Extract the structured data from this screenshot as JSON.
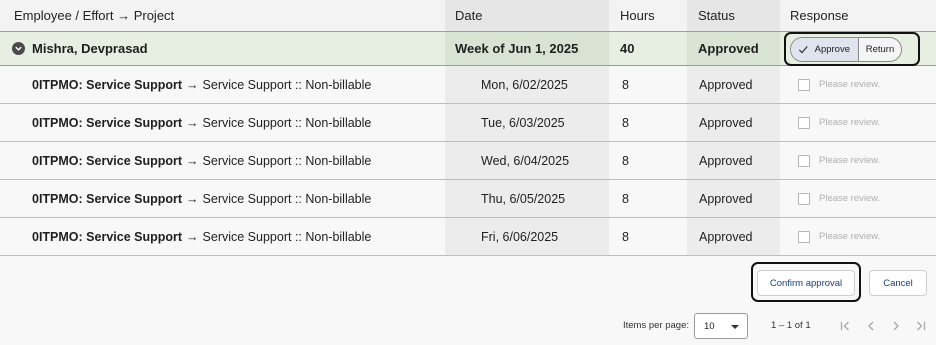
{
  "header": {
    "employee_col": "Employee / Effort → Project",
    "date_col": "Date",
    "hours_col": "Hours",
    "status_col": "Status",
    "response_col": "Response"
  },
  "group": {
    "name": "Mishra, Devprasad",
    "week": "Week of Jun 1, 2025",
    "hours": "40",
    "status": "Approved",
    "approve_label": "Approve",
    "return_label": "Return"
  },
  "rows": [
    {
      "project_code": "0ITPMO: Service Support",
      "project_detail": "Service Support :: Non-billable",
      "date": "Mon, 6/02/2025",
      "hours": "8",
      "status": "Approved",
      "review_placeholder": "Please review."
    },
    {
      "project_code": "0ITPMO: Service Support",
      "project_detail": "Service Support :: Non-billable",
      "date": "Tue, 6/03/2025",
      "hours": "8",
      "status": "Approved",
      "review_placeholder": "Please review."
    },
    {
      "project_code": "0ITPMO: Service Support",
      "project_detail": "Service Support :: Non-billable",
      "date": "Wed, 6/04/2025",
      "hours": "8",
      "status": "Approved",
      "review_placeholder": "Please review."
    },
    {
      "project_code": "0ITPMO: Service Support",
      "project_detail": "Service Support :: Non-billable",
      "date": "Thu, 6/05/2025",
      "hours": "8",
      "status": "Approved",
      "review_placeholder": "Please review."
    },
    {
      "project_code": "0ITPMO: Service Support",
      "project_detail": "Service Support :: Non-billable",
      "date": "Fri, 6/06/2025",
      "hours": "8",
      "status": "Approved",
      "review_placeholder": "Please review."
    }
  ],
  "arrow": "→",
  "actions": {
    "confirm_label": "Confirm approval",
    "cancel_label": "Cancel"
  },
  "pagination": {
    "items_per_page_label": "Items per page:",
    "items_per_page_value": "10",
    "range_label": "1 – 1 of 1"
  },
  "icons": {
    "expand": "chevron-down-circle-icon",
    "approve": "checkmark-icon",
    "first_page": "first-page-icon",
    "prev_page": "chevron-left-icon",
    "next_page": "chevron-right-icon",
    "last_page": "last-page-icon"
  },
  "colors": {
    "group_row_bg": "#e6efe1",
    "approve_selected_bg": "#dfe4ee",
    "action_text": "#1a3f7a"
  }
}
